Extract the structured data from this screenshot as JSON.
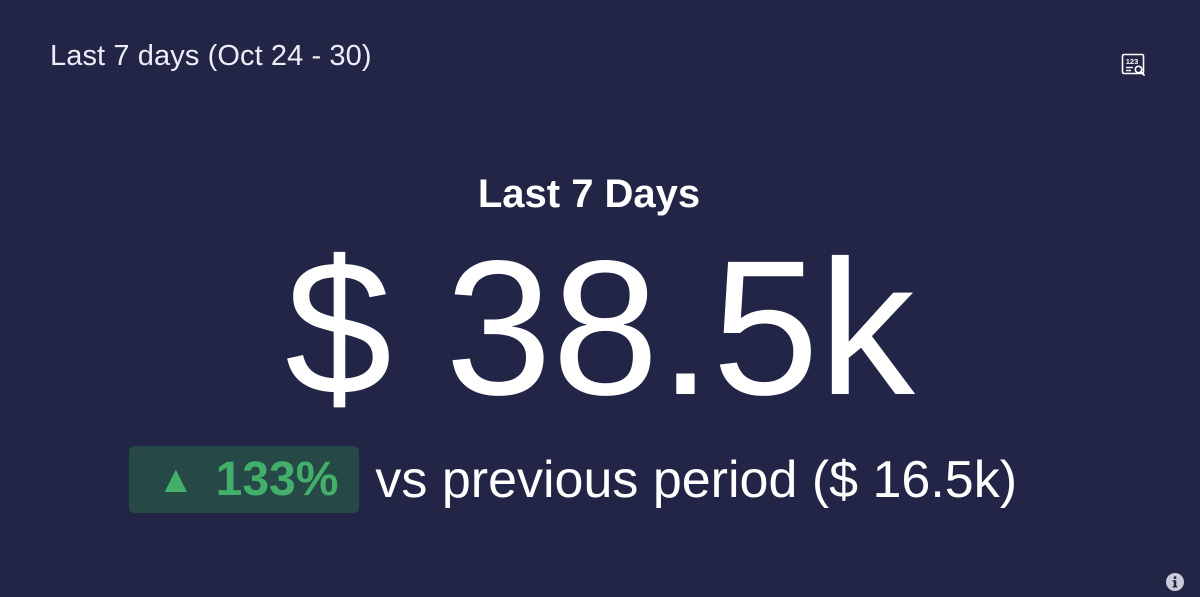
{
  "header": {
    "title": "Last 7 days (Oct 24 - 30)",
    "metric_icon": "metric-details-icon"
  },
  "metric": {
    "label": "Last 7 Days",
    "value": "$ 38.5k"
  },
  "comparison": {
    "direction": "up",
    "arrow_glyph": "▲",
    "change_percent": "133%",
    "text": "vs previous period ($ 16.5k)"
  },
  "footer": {
    "info_icon": "info-icon"
  },
  "colors": {
    "background": "#222546",
    "positive": "#42b06a",
    "positive_badge_bg": "#264948",
    "text": "#ffffff"
  }
}
